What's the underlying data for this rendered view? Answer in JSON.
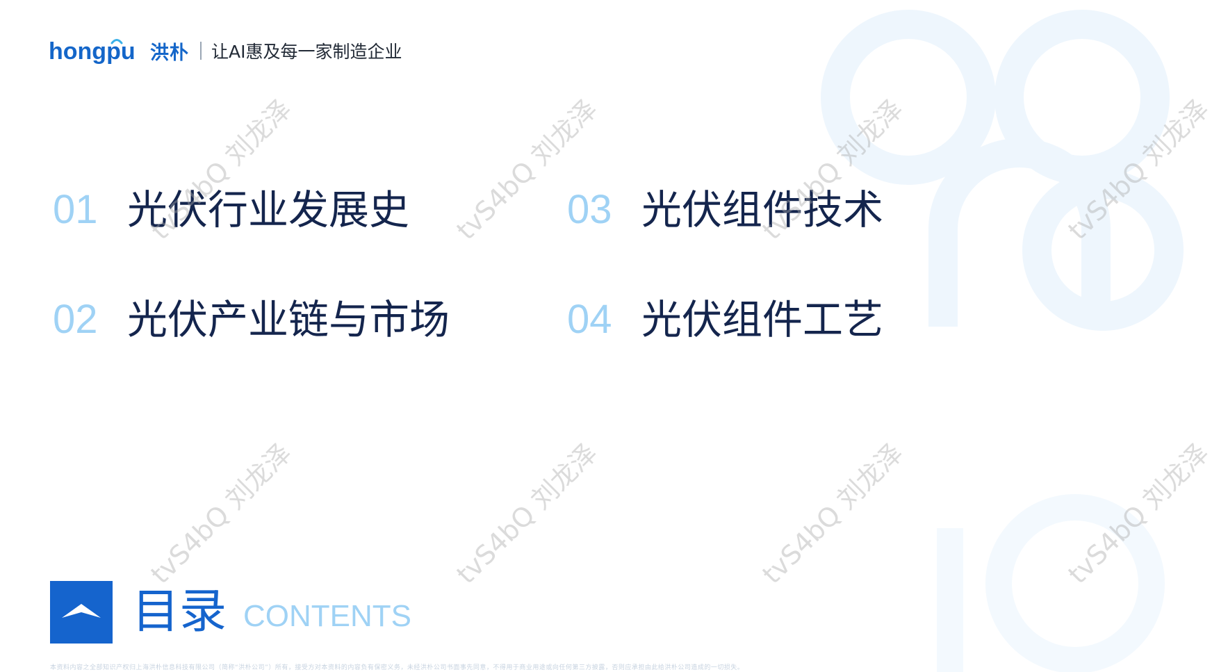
{
  "header": {
    "brand_en": "hongpu",
    "brand_cn": "洪朴",
    "slogan": "让AI惠及每一家制造企业"
  },
  "toc": [
    {
      "number": "01",
      "title": "光伏行业发展史"
    },
    {
      "number": "02",
      "title": "光伏产业链与市场"
    },
    {
      "number": "03",
      "title": "光伏组件技术"
    },
    {
      "number": "04",
      "title": "光伏组件工艺"
    }
  ],
  "section": {
    "title_cn": "目录",
    "title_en": "CONTENTS"
  },
  "footer": {
    "note": "本资料内容之全部知识产权归上海洪朴信息科技有限公司（简称“洪朴公司”）所有，接受方对本资料的内容负有保密义务，未经洪朴公司书面事先同意，不得用于商业用途或向任何第三方披露，否则应承担由此给洪朴公司造成的一切损失。"
  },
  "watermark": {
    "text": "tvS4bQ 刘龙泽"
  },
  "colors": {
    "brand_blue": "#1564cd",
    "number_light_blue": "#9fd2f5",
    "title_navy": "#14254d"
  },
  "icons": {
    "heading_icon": "chevron-up-icon",
    "logo": "hongpu-logo"
  }
}
